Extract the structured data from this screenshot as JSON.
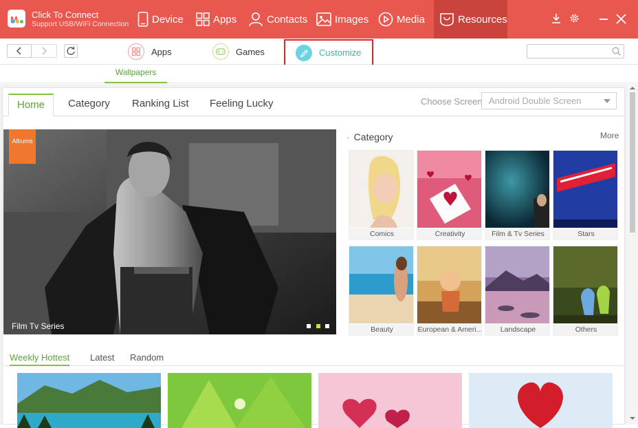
{
  "app": {
    "connect_title": "Click To Connect",
    "connect_sub": "Support USB/WiFi Connection"
  },
  "topnav": {
    "device": "Device",
    "apps": "Apps",
    "contacts": "Contacts",
    "images": "Images",
    "media": "Media",
    "resources": "Resources"
  },
  "subnav": {
    "apps": "Apps",
    "games": "Games",
    "customize": "Customize",
    "search_placeholder": ""
  },
  "wallpapers_tab": "Wallpapers",
  "home_tabs": {
    "home": "Home",
    "category": "Category",
    "ranking": "Ranking List",
    "lucky": "Feeling Lucky"
  },
  "screen_choice": {
    "label": "Choose Screen",
    "selected": "Android Double Screen"
  },
  "banner": {
    "badge": "Albums",
    "caption": "Film Tv Series"
  },
  "category_section": {
    "heading": "Category",
    "more": "More",
    "items": [
      {
        "label": "Comics"
      },
      {
        "label": "Creativity"
      },
      {
        "label": "Film & Tv Series"
      },
      {
        "label": "Stars"
      },
      {
        "label": "Beauty"
      },
      {
        "label": "European & Ameri..."
      },
      {
        "label": "Landscape"
      },
      {
        "label": "Others"
      }
    ]
  },
  "weekly_tabs": {
    "hottest": "Weekly Hottest",
    "latest": "Latest",
    "random": "Random"
  },
  "colors": {
    "brand_red": "#e9584e",
    "active_green": "#5ba43a",
    "customize_teal": "#39b6a8",
    "highlight_box": "#e02424"
  }
}
